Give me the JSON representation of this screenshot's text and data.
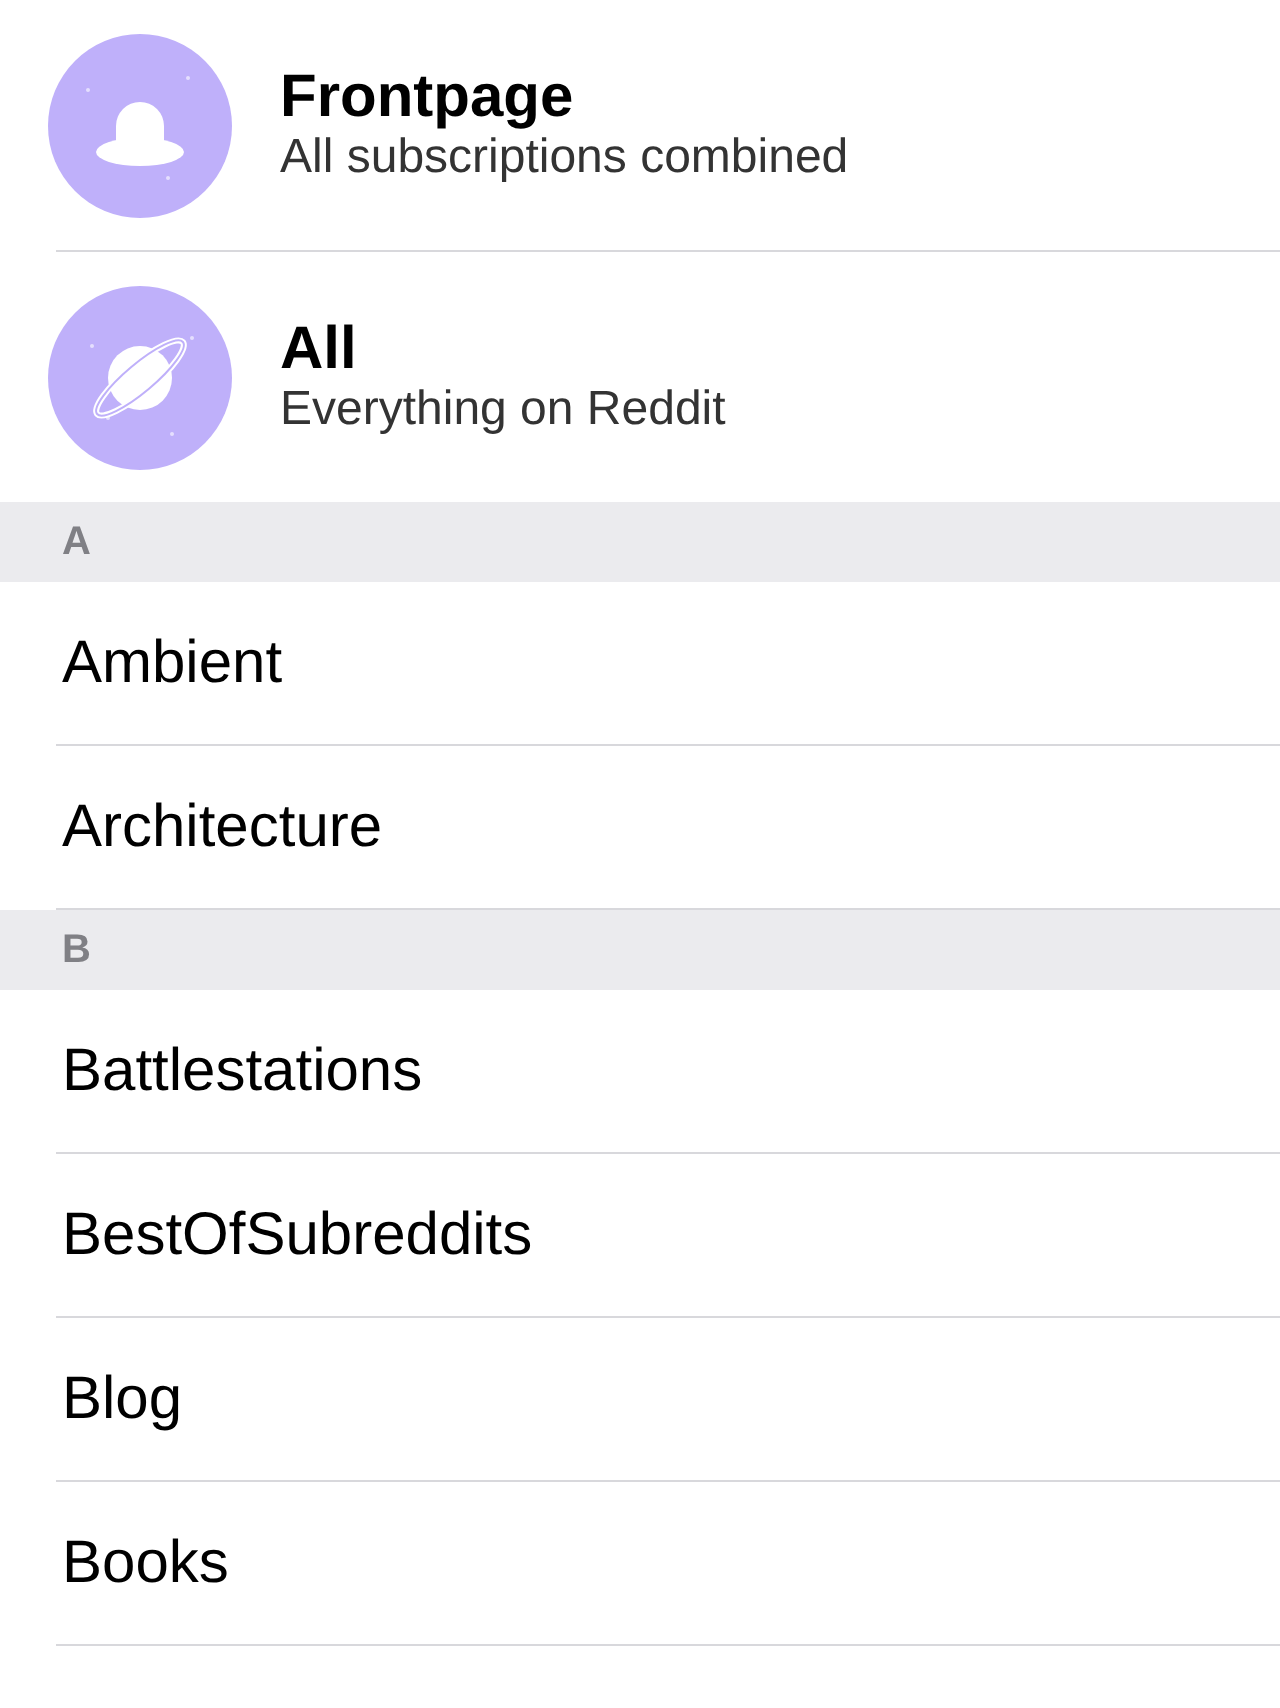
{
  "feeds": [
    {
      "kind": "hat",
      "title": "Frontpage",
      "subtitle": "All subscriptions combined"
    },
    {
      "kind": "planet",
      "title": "All",
      "subtitle": "Everything on Reddit"
    }
  ],
  "sections": [
    {
      "letter": "A",
      "items": [
        "Ambient",
        "Architecture"
      ]
    },
    {
      "letter": "B",
      "items": [
        "Battlestations",
        "BestOfSubreddits",
        "Blog",
        "Books"
      ]
    }
  ]
}
